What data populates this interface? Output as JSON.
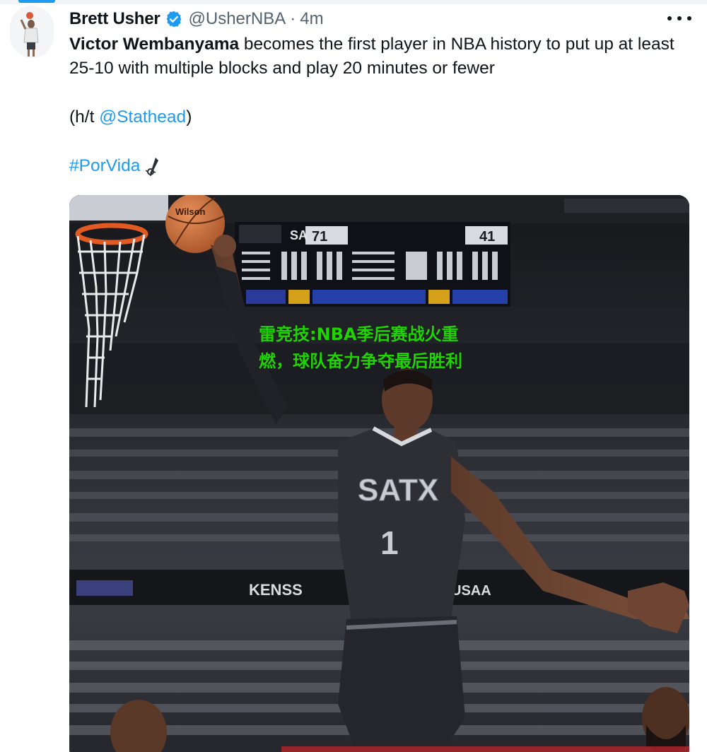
{
  "tweet": {
    "author_name": "Brett Usher",
    "handle": "@UsherNBA",
    "separator": "·",
    "time_ago": "4m",
    "text_name": "Victor Wembanyama",
    "text_rest": " becomes the first player in NBA history to put up at least 25-10 with multiple blocks and play 20 minutes or fewer",
    "ht_prefix": "(h/t ",
    "ht_mention": "@Stathead",
    "ht_suffix": ")",
    "hashtag": "#PorVida"
  },
  "photo": {
    "scoreboard_home": "SA",
    "scoreboard_home_score": "71",
    "scoreboard_away_score": "41",
    "ball_brand": "Wilson",
    "jersey_team": "SATX",
    "jersey_number": "1",
    "banner_center": "KENSS",
    "banner_right": "USAA"
  },
  "overlay": {
    "caption": "雷竞技:NBA季后赛战火重燃，球队奋力争夺最后胜利"
  },
  "colors": {
    "link": "#1d9bf0",
    "verified": "#1d9bf0",
    "overlay_text": "#1fd400"
  }
}
